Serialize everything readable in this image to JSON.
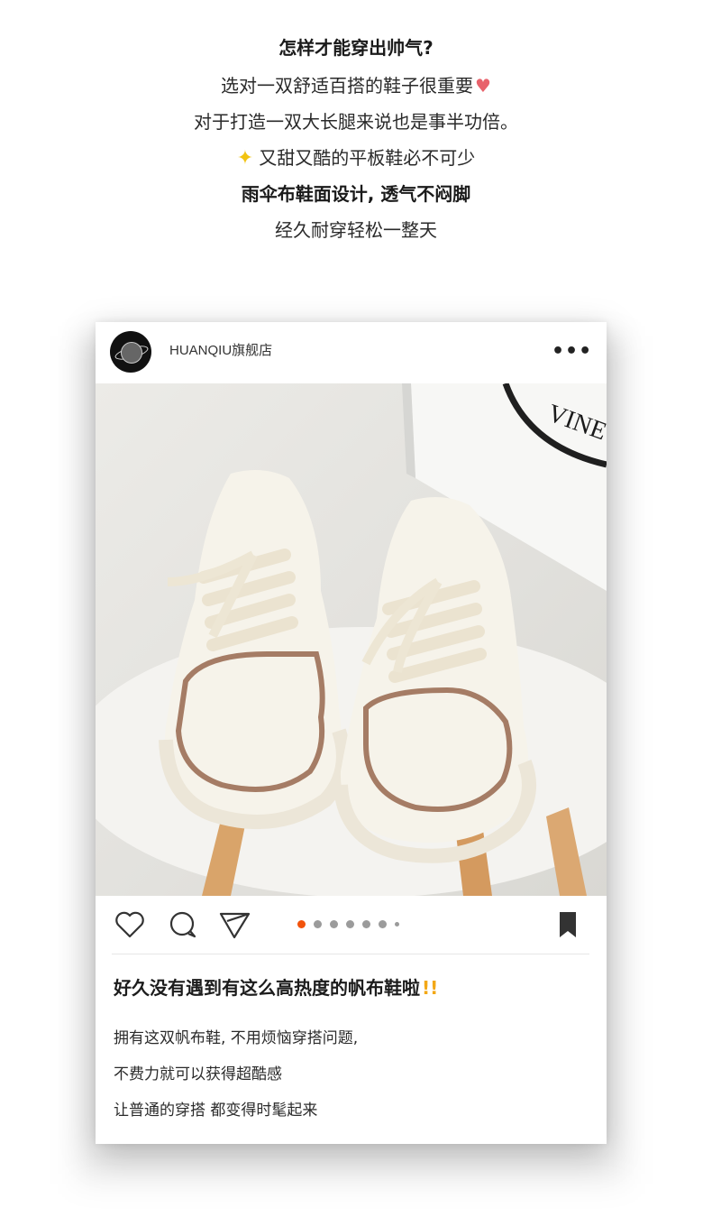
{
  "intro": {
    "line1": "怎样才能穿出帅气?",
    "line2": "选对一双舒适百搭的鞋子很重要",
    "line3": "对于打造一双大长腿来说也是事半功倍。",
    "line4": "又甜又酷的平板鞋必不可少",
    "line5": "雨伞布鞋面设计, 透气不闷脚",
    "line6": "经久耐穿轻松一整天"
  },
  "post": {
    "store_name": "HUANQIU旗舰店",
    "more_label": "•••",
    "title": "好久没有遇到有这么高热度的帆布鞋啦",
    "title_bang": "!!",
    "line1": "拥有这双帆布鞋, 不用烦恼穿搭问题,",
    "line2": "不费力就可以获得超酷感",
    "line3": "让普通的穿搭 都变得时髦起来",
    "bag_text": "VINEY",
    "carousel_count": 7,
    "carousel_active": 0
  },
  "icons": {
    "like": "heart-outline-icon",
    "comment": "comment-bubble-icon",
    "share": "paper-plane-icon",
    "save": "bookmark-icon",
    "heart_emoji": "red-heart-icon",
    "sparkle": "sparkles-icon"
  },
  "colors": {
    "carousel_active": "#f2530c",
    "carousel_inactive": "#9b9b9b",
    "heart": "#e8626b",
    "sparkle": "#f2c311",
    "exclamation": "#f3a816"
  }
}
